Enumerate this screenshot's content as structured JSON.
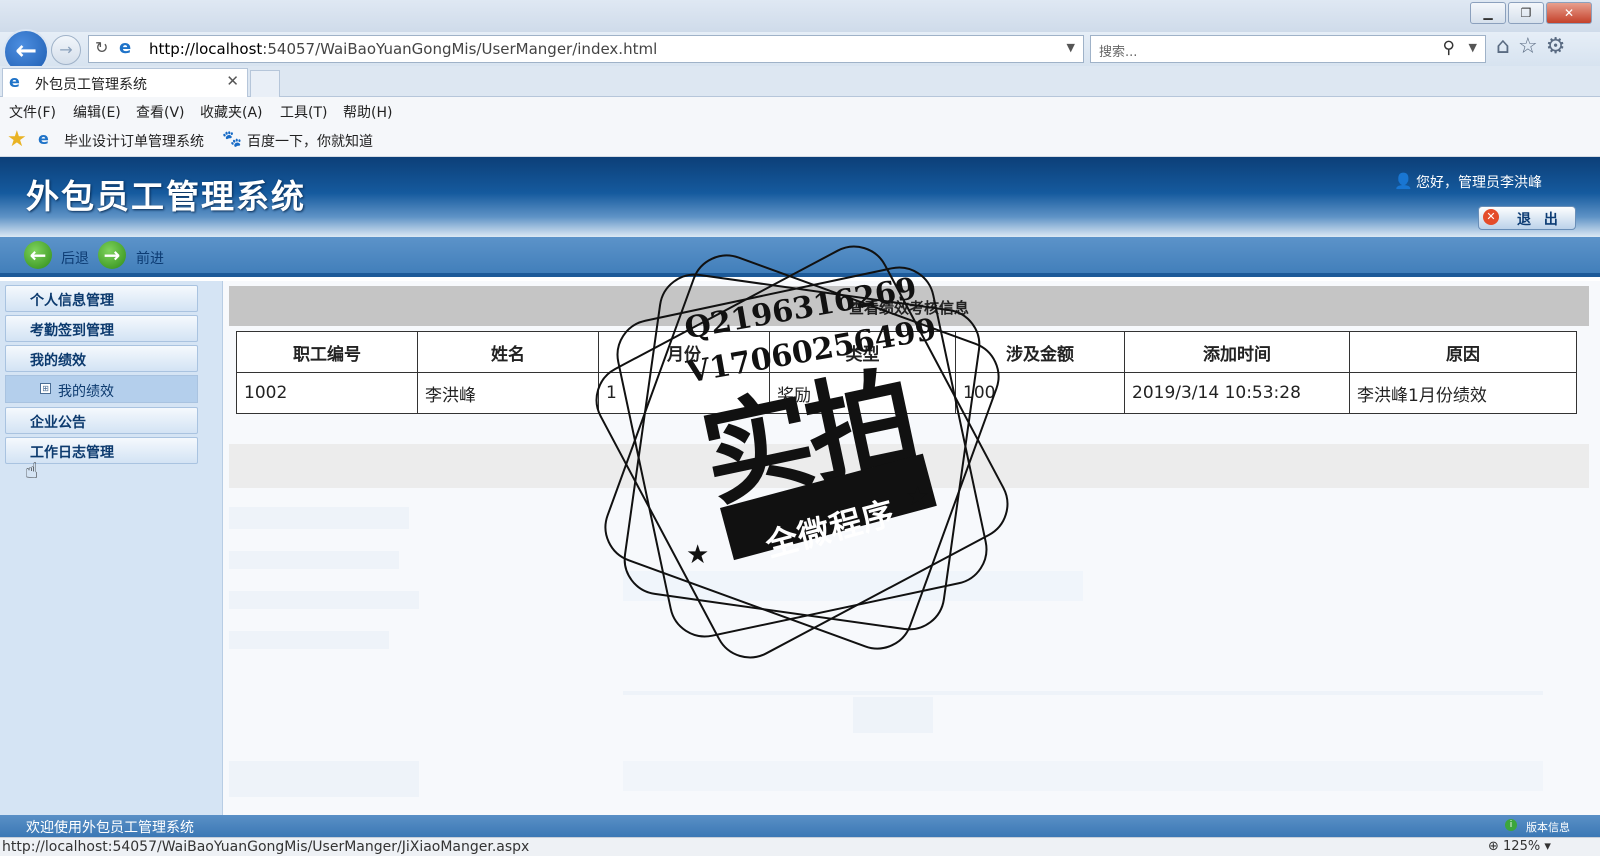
{
  "browser": {
    "url_host": "http://localhost",
    "url_rest": ":54057/WaiBaoYuanGongMis/UserManger/index.html",
    "search_placeholder": "搜索...",
    "tab_title": "外包员工管理系统",
    "menu": [
      "文件(F)",
      "编辑(E)",
      "查看(V)",
      "收藏夹(A)",
      "工具(T)",
      "帮助(H)"
    ],
    "favorites": [
      "毕业设计订单管理系统",
      "百度一下，你就知道"
    ],
    "status_url": "http://localhost:54057/WaiBaoYuanGongMis/UserManger/JiXiaoManger.aspx",
    "zoom": "125%"
  },
  "app": {
    "title": "外包员工管理系统",
    "greeting": "您好，管理员李洪峰",
    "logout_label": "退 出",
    "nav_back": "后退",
    "nav_forward": "前进",
    "footer_welcome": "欢迎使用外包员工管理系统",
    "version_label": "版本信息"
  },
  "sidebar": {
    "items": [
      {
        "label": "个人信息管理"
      },
      {
        "label": "考勤签到管理"
      },
      {
        "label": "我的绩效"
      },
      {
        "label": "企业公告"
      },
      {
        "label": "工作日志管理"
      }
    ],
    "subitem": {
      "label": "我的绩效"
    }
  },
  "main": {
    "panel_title": "查看绩效考核信息",
    "columns": [
      "职工编号",
      "姓名",
      "月份",
      "类型",
      "涉及金额",
      "添加时间",
      "原因"
    ],
    "rows": [
      [
        "1002",
        "李洪峰",
        "1",
        "奖励",
        "100",
        "2019/3/14 10:53:28",
        "李洪峰1月份绩效"
      ]
    ]
  },
  "watermark": {
    "line1": "Q2196316269",
    "line2": "V17060256499",
    "big": "实拍",
    "ribbon": "全微程序"
  }
}
